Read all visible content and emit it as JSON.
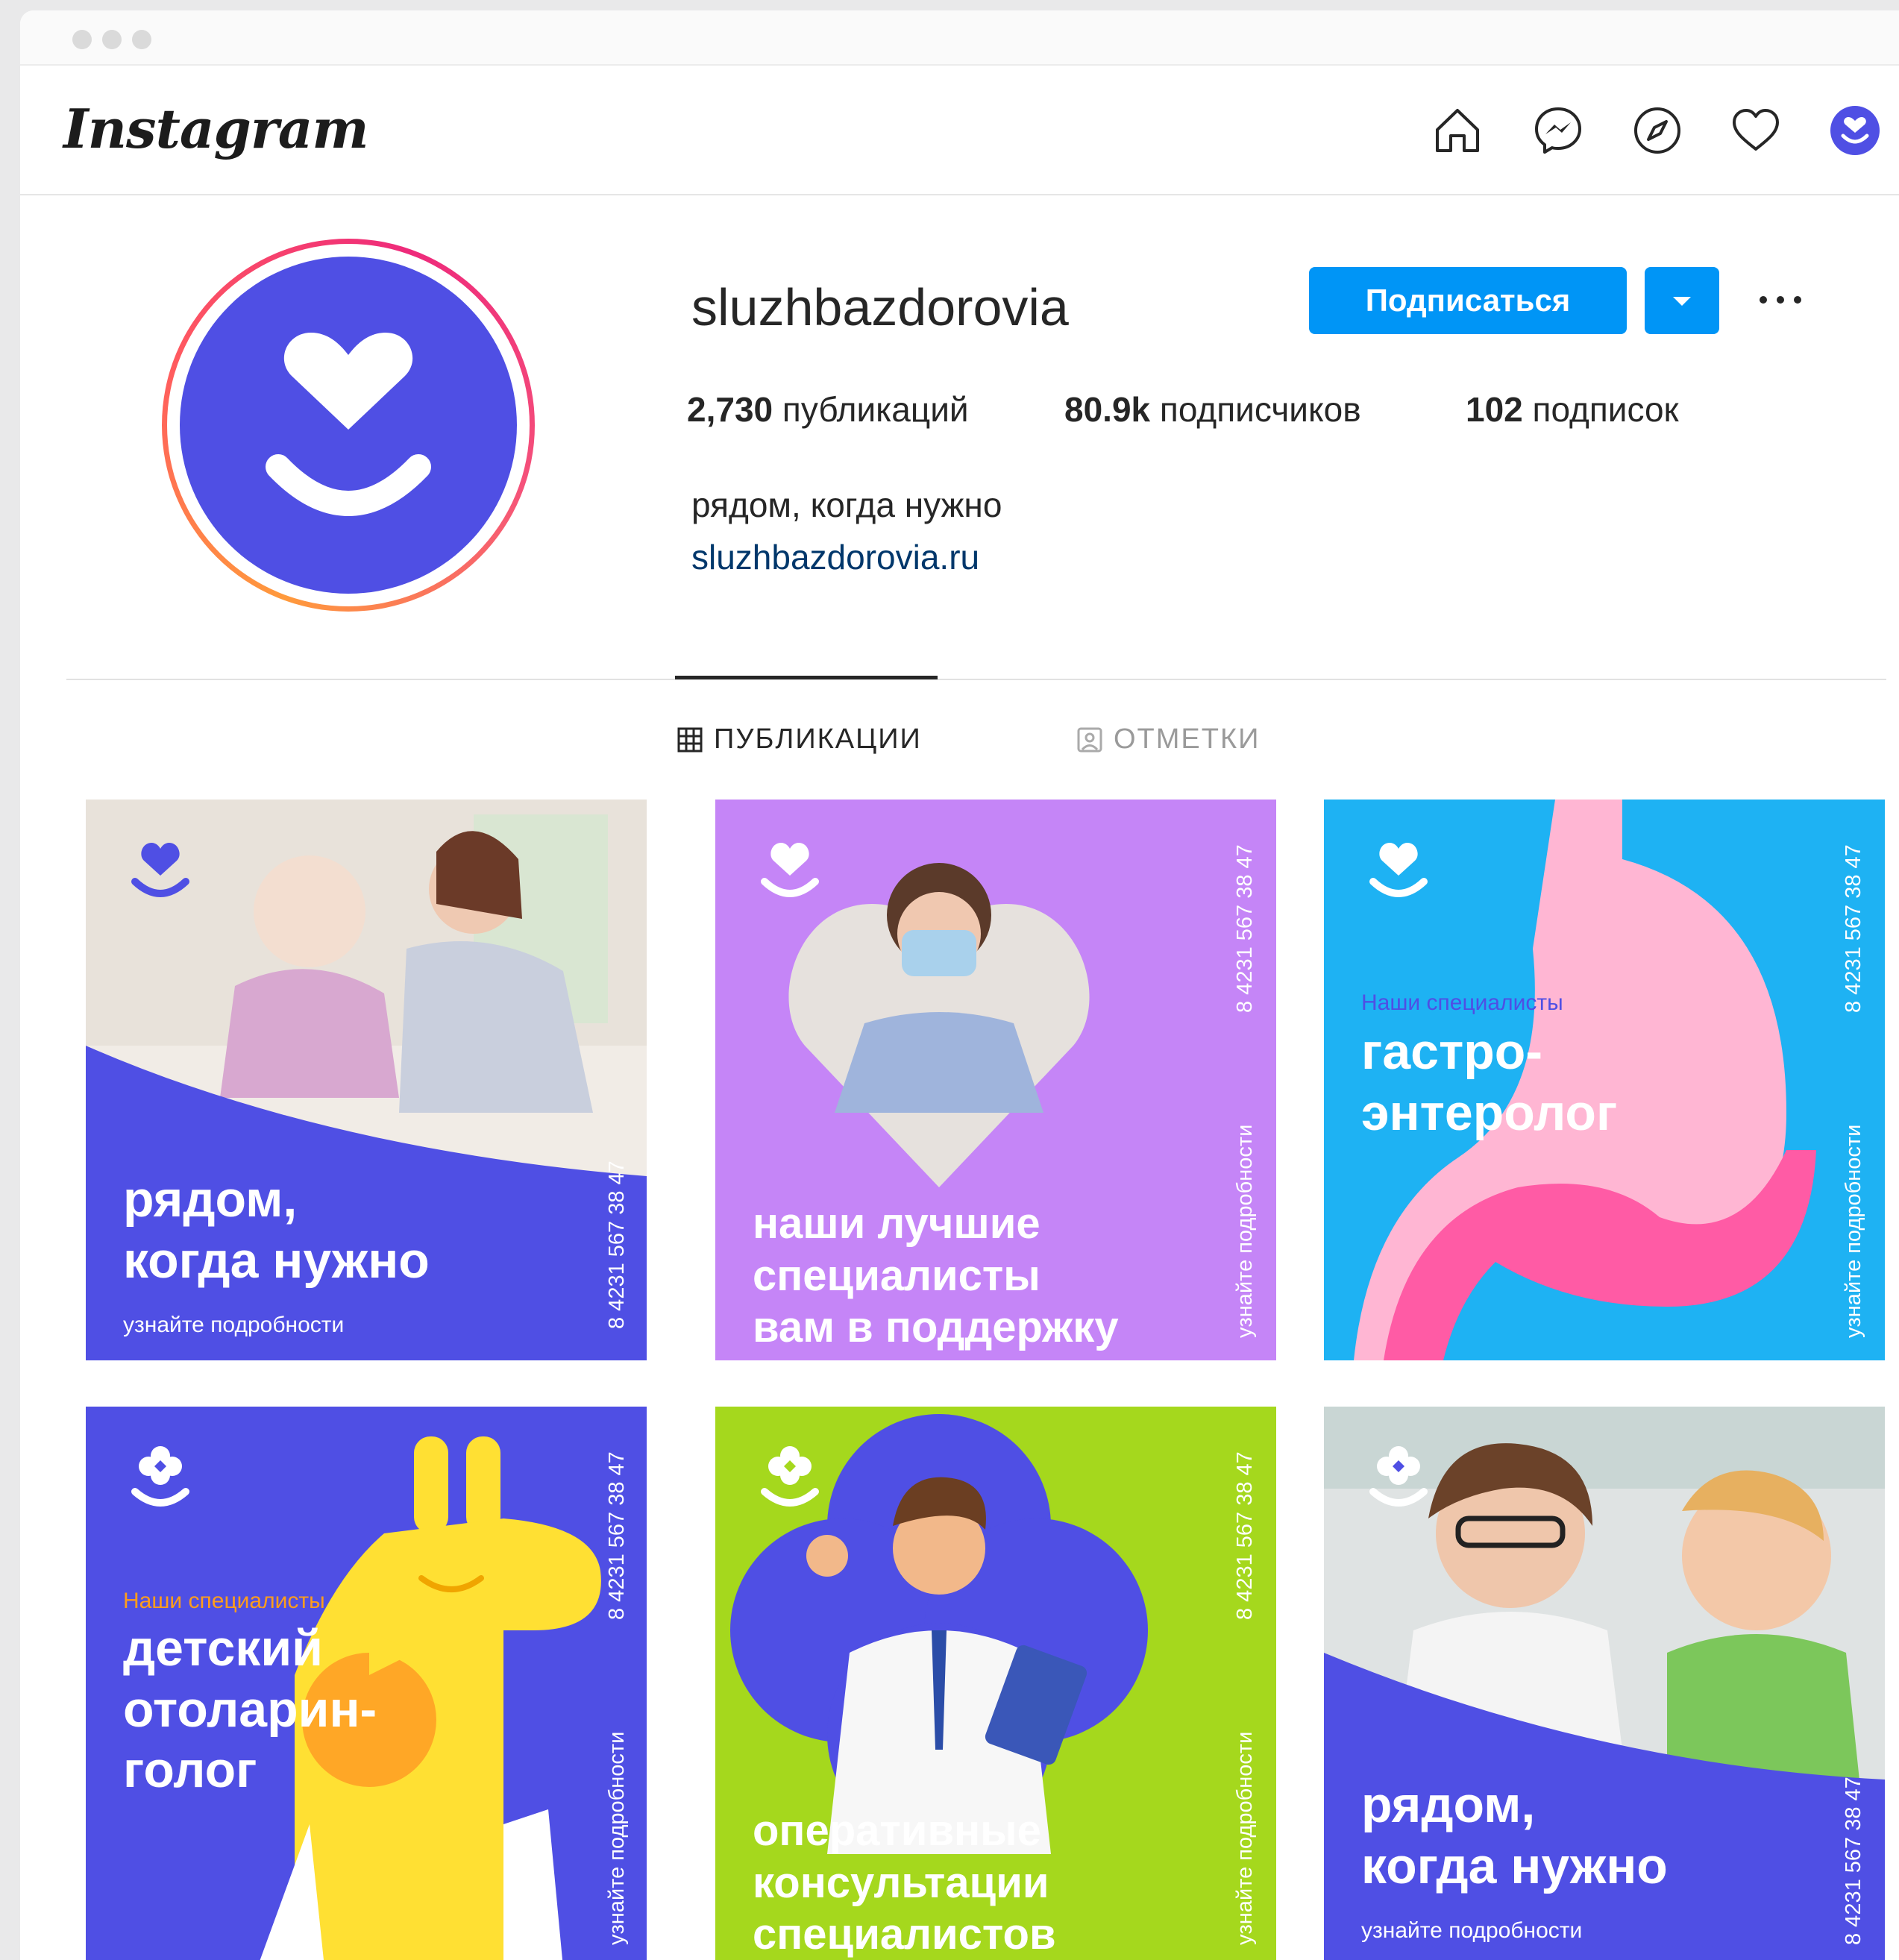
{
  "app": {
    "logo": "Instagram"
  },
  "nav": {
    "icons": [
      "home-icon",
      "messenger-icon",
      "explore-icon",
      "activity-heart-icon",
      "profile-avatar-icon"
    ]
  },
  "profile": {
    "username": "sluzhbazdorovia",
    "follow_label": "Подписаться",
    "stats": {
      "posts_count": "2,730",
      "posts_label": "публикаций",
      "followers_count": "80.9k",
      "followers_label": "подписчиков",
      "following_count": "102",
      "following_label": "подписок"
    },
    "bio": "рядом, когда нужно",
    "website": "sluzhbazdorovia.ru"
  },
  "tabs": [
    {
      "label": "ПУБЛИКАЦИИ",
      "icon": "grid-icon",
      "active": true
    },
    {
      "label": "ОТМЕТКИ",
      "icon": "tagged-icon",
      "active": false
    }
  ],
  "colors": {
    "brand": "#4f4fe4",
    "button": "#0095f6",
    "violet": "#c585f7",
    "sky": "#1eb2f3",
    "lime": "#a5d81d",
    "pink": "#ff5ba5",
    "orange": "#ff9d1c"
  },
  "posts": [
    {
      "headline": "рядом,\nкогда нужно",
      "sub": "узнайте подробности",
      "phone": "8 4231 567 38 47"
    },
    {
      "headline": "наши лучшие\nспециалисты\nвам в поддержку",
      "side_text": "узнайте подробности",
      "phone": "8 4231 567 38 47"
    },
    {
      "kicker": "Наши специалисты",
      "headline": "гастро-\nэнтеролог",
      "side_text": "узнайте подробности",
      "phone": "8 4231 567 38 47"
    },
    {
      "kicker": "Наши специалисты",
      "headline": "детский\nотоларин-\nголог",
      "side_text": "узнайте подробности",
      "phone": "8 4231 567 38 47"
    },
    {
      "headline": "оперативные\nконсультации\nспециалистов",
      "side_text": "узнайте подробности",
      "phone": "8 4231 567 38 47"
    },
    {
      "headline": "рядом,\nкогда нужно",
      "sub": "узнайте подробности",
      "phone": "8 4231 567 38 47"
    }
  ]
}
